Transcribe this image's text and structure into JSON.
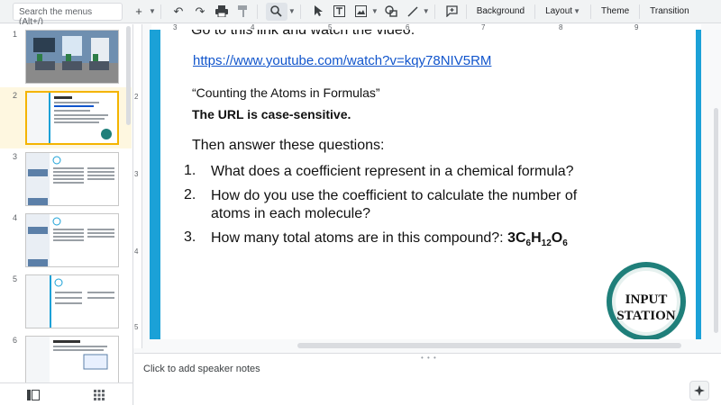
{
  "toolbar": {
    "search_placeholder": "Search the menus (Alt+/)",
    "background_label": "Background",
    "layout_label": "Layout",
    "theme_label": "Theme",
    "transition_label": "Transition"
  },
  "filmstrip": {
    "slides": [
      {
        "number": "1"
      },
      {
        "number": "2"
      },
      {
        "number": "3"
      },
      {
        "number": "4"
      },
      {
        "number": "5"
      },
      {
        "number": "6"
      }
    ],
    "active_slide": "2"
  },
  "ruler": {
    "h_numbers": [
      "3",
      "4",
      "5",
      "6",
      "7",
      "8",
      "9"
    ],
    "v_numbers": [
      "2",
      "3",
      "4",
      "5"
    ]
  },
  "slide": {
    "top_text": "Go to this link and watch the video:",
    "link": "https://www.youtube.com/watch?v=kqy78NIV5RM",
    "video_title": "“Counting the Atoms in Formulas”",
    "url_note": "The URL is case-sensitive.",
    "intro": "Then answer these questions:",
    "questions": [
      {
        "num": "1.",
        "line1": "What does a coefficient represent in a chemical formula?",
        "line2": ""
      },
      {
        "num": "2.",
        "line1": "How do you use the coefficient to calculate the number of",
        "line2": "atoms in each molecule?"
      },
      {
        "num": "3.",
        "line1": "How many total atoms are in this compound?:",
        "line2": ""
      }
    ],
    "formula": {
      "c_coef": "3C",
      "c_sub": "6",
      "h": "H",
      "h_sub": "12",
      "o": "O",
      "o_sub": "6"
    },
    "badge": {
      "line1": "INPUT",
      "line2": "STATION",
      "color": "#1f7f7a"
    },
    "accent_color": "#1ba1d7"
  },
  "notes": {
    "placeholder": "Click to add speaker notes"
  }
}
